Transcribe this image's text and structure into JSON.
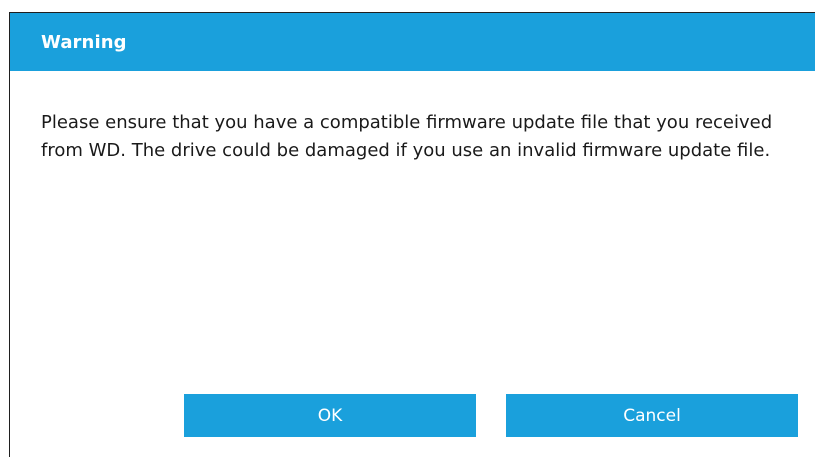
{
  "dialog": {
    "title": "Warning",
    "message": "Please ensure that you have a compatible firmware update file that you received from WD. The drive could be damaged if you use an invalid firmware update file.",
    "ok_label": "OK",
    "cancel_label": "Cancel"
  },
  "colors": {
    "accent": "#1aa0dc",
    "text": "#1a1a1a",
    "background": "#ffffff"
  }
}
